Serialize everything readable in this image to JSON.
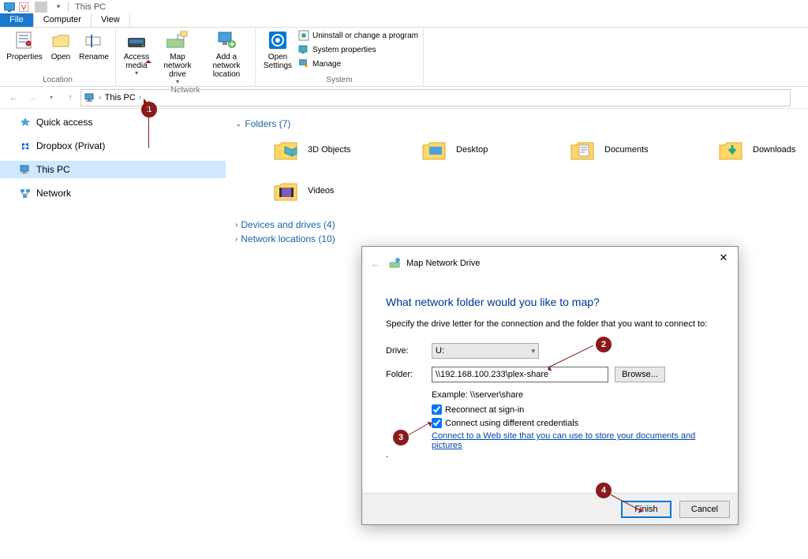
{
  "titlebar": {
    "title": "This PC"
  },
  "tabs": {
    "file": "File",
    "computer": "Computer",
    "view": "View"
  },
  "ribbon": {
    "group_location": "Location",
    "group_network": "Network",
    "group_system": "System",
    "properties": "Properties",
    "open": "Open",
    "rename": "Rename",
    "access_media": "Access media",
    "map_drive": "Map network drive",
    "add_location": "Add a network location",
    "open_settings": "Open Settings",
    "uninstall": "Uninstall or change a program",
    "sys_props": "System properties",
    "manage": "Manage"
  },
  "addr": {
    "thispc": "This PC"
  },
  "sidebar": {
    "quick": "Quick access",
    "dropbox": "Dropbox (Privat)",
    "thispc": "This PC",
    "network": "Network"
  },
  "content": {
    "folders_header": "Folders (7)",
    "devices_header": "Devices and drives (4)",
    "netloc_header": "Network locations (10)",
    "folders": [
      "3D Objects",
      "Desktop",
      "Documents",
      "Downloads",
      "Videos"
    ]
  },
  "dialog": {
    "title": "Map Network Drive",
    "heading": "What network folder would you like to map?",
    "instruction": "Specify the drive letter for the connection and the folder that you want to connect to:",
    "drive_label": "Drive:",
    "drive_value": "U:",
    "folder_label": "Folder:",
    "folder_value": "\\\\192.168.100.233\\plex-share",
    "browse": "Browse...",
    "example": "Example: \\\\server\\share",
    "reconnect": "Reconnect at sign-in",
    "diff_creds": "Connect using different credentials",
    "link": "Connect to a Web site that you can use to store your documents and pictures",
    "finish": "Finish",
    "cancel": "Cancel"
  },
  "badges": {
    "b1": "1",
    "b2": "2",
    "b3": "3",
    "b4": "4"
  }
}
